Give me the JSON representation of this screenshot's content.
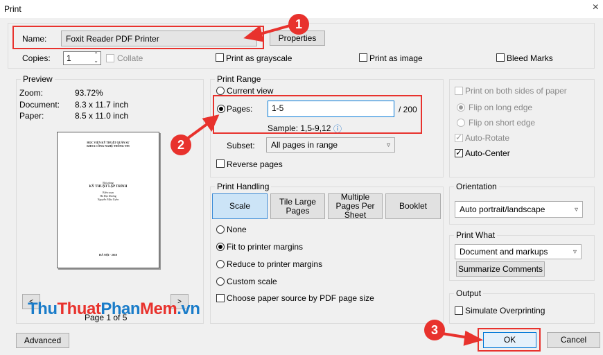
{
  "window": {
    "title": "Print",
    "close_glyph": "×"
  },
  "printer": {
    "name_label": "Name:",
    "name_value": "Foxit Reader PDF Printer",
    "properties_label": "Properties",
    "copies_label": "Copies:",
    "copies_value": "1",
    "collate_label": "Collate",
    "grayscale_label": "Print as grayscale",
    "as_image_label": "Print as image",
    "bleed_marks_label": "Bleed Marks"
  },
  "preview": {
    "legend": "Preview",
    "zoom_label": "Zoom:",
    "zoom_value": "93.72%",
    "document_label": "Document:",
    "document_value": "8.3 x 11.7 inch",
    "paper_label": "Paper:",
    "paper_value": "8.5 x 11.0 inch",
    "page_header_1": "HỌC VIỆN KỸ THUẬT QUÂN SỰ",
    "page_header_2": "KHOA CÔNG NGHỆ THÔNG TIN",
    "page_subject": "Bài giảng",
    "page_title": "KỸ THUẬT LẬP TRÌNH",
    "page_authors_1": "Biên soạn",
    "page_authors_2": "Hà Đại Dương",
    "page_authors_3": "Nguyễn Mậu Uyên",
    "page_footer": "HÀ NỘI - 2010",
    "page_indicator": "Page 1 of 5",
    "prev_glyph": "<",
    "next_glyph": ">"
  },
  "print_range": {
    "legend": "Print Range",
    "current_view_label": "Current view",
    "pages_label": "Pages:",
    "pages_value": "1-5",
    "total_pages": "/ 200",
    "sample_text": "Sample: 1,5-9,12",
    "info_glyph": "ⓘ",
    "subset_label": "Subset:",
    "subset_value": "All pages in range",
    "reverse_label": "Reverse pages"
  },
  "print_handling": {
    "legend": "Print Handling",
    "tabs": [
      "Scale",
      "Tile Large Pages",
      "Multiple Pages Per Sheet",
      "Booklet"
    ],
    "none_label": "None",
    "fit_label": "Fit to printer margins",
    "reduce_label": "Reduce to printer margins",
    "custom_label": "Custom scale",
    "paper_source_label": "Choose paper source by PDF page size"
  },
  "duplex": {
    "both_sides_label": "Print on both sides of paper",
    "long_edge_label": "Flip on long edge",
    "short_edge_label": "Flip on short edge",
    "auto_rotate_label": "Auto-Rotate",
    "auto_center_label": "Auto-Center"
  },
  "orientation": {
    "legend": "Orientation",
    "value": "Auto portrait/landscape"
  },
  "print_what": {
    "legend": "Print What",
    "value": "Document and markups",
    "summarize_label": "Summarize Comments"
  },
  "output": {
    "legend": "Output",
    "simulate_label": "Simulate Overprinting"
  },
  "footer": {
    "advanced_label": "Advanced",
    "ok_label": "OK",
    "cancel_label": "Cancel"
  },
  "annotations": {
    "badge_1": "1",
    "badge_2": "2",
    "badge_3": "3",
    "color": "#e8322d"
  },
  "watermark": {
    "part1": "Thu",
    "part2": "Thuat",
    "part3": "Phan",
    "part4": "Mem",
    "part5": ".vn"
  }
}
